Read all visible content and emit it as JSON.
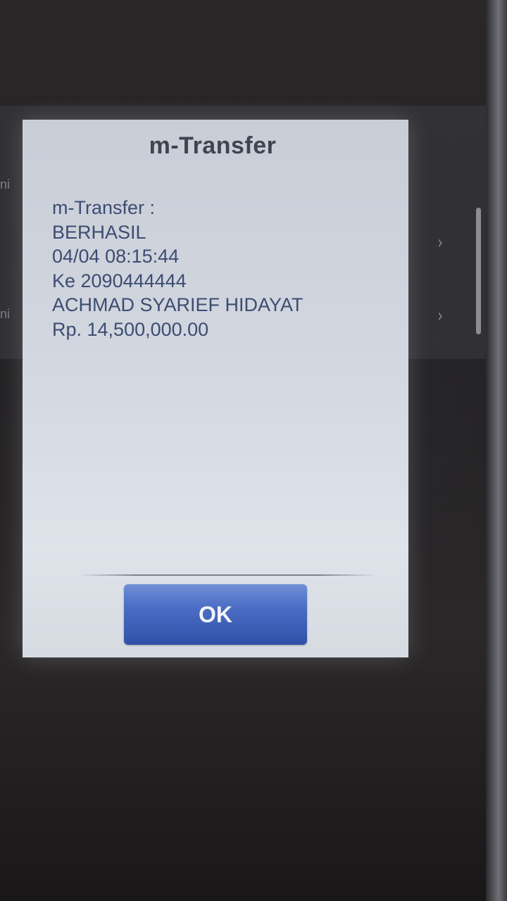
{
  "dialog": {
    "title": "m-Transfer",
    "message_lines": [
      "m-Transfer :",
      "BERHASIL",
      "04/04 08:15:44",
      "Ke 2090444444",
      "ACHMAD SYARIEF HIDAYAT",
      "Rp. 14,500,000.00"
    ],
    "ok_label": "OK"
  },
  "background": {
    "side_text_1": "ni",
    "side_text_2": "ni",
    "chevron": "›"
  },
  "colors": {
    "dialog_bg": "#d2d7e0",
    "title_text": "#3f4550",
    "message_text": "#3c4d72",
    "button_blue": "#3a5db5"
  }
}
